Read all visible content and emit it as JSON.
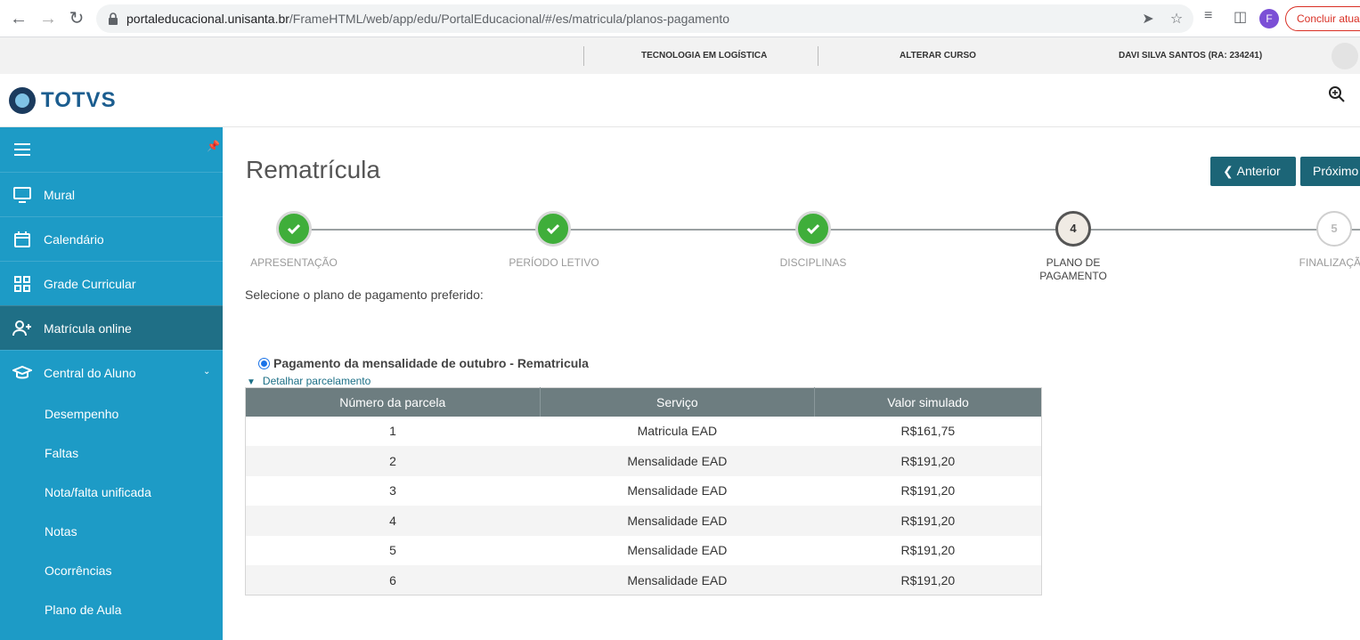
{
  "browser": {
    "url_host": "portaleducacional.unisanta.br",
    "url_path": "/FrameHTML/web/app/edu/PortalEducacional/#/es/matricula/planos-pagamento",
    "profile_initial": "F",
    "update_label": "Concluir atualização"
  },
  "topbar": {
    "course": "TECNOLOGIA EM LOGÍSTICA",
    "change_course": "ALTERAR CURSO",
    "user": "DAVI SILVA SANTOS (RA: 234241)"
  },
  "header": {
    "logo_text": "TOTVS"
  },
  "sidebar": {
    "items": [
      {
        "label": "Mural",
        "icon": "monitor-icon"
      },
      {
        "label": "Calendário",
        "icon": "calendar-icon"
      },
      {
        "label": "Grade Curricular",
        "icon": "grid-icon"
      },
      {
        "label": "Matrícula online",
        "icon": "add-user-icon"
      },
      {
        "label": "Central do Aluno",
        "icon": "graduation-cap-icon"
      }
    ],
    "subitems": [
      "Desempenho",
      "Faltas",
      "Nota/falta unificada",
      "Notas",
      "Ocorrências",
      "Plano de Aula"
    ]
  },
  "main": {
    "title": "Rematrícula",
    "prev_label": "Anterior",
    "next_label": "Próximo",
    "steps": [
      {
        "label": "APRESENTAÇÃO",
        "state": "done"
      },
      {
        "label": "PERÍODO LETIVO",
        "state": "done"
      },
      {
        "label": "DISCIPLINAS",
        "state": "done"
      },
      {
        "label": "PLANO DE PAGAMENTO",
        "number": "4",
        "state": "current"
      },
      {
        "label": "FINALIZAÇÃO",
        "number": "5",
        "state": "pending"
      }
    ],
    "intro": "Selecione o plano de pagamento preferido:",
    "option_label": "Pagamento da mensalidade de outubro - Rematricula",
    "detail_link": "Detalhar parcelamento",
    "table": {
      "headers": [
        "Número da parcela",
        "Serviço",
        "Valor simulado"
      ],
      "rows": [
        [
          "1",
          "Matricula EAD",
          "R$161,75"
        ],
        [
          "2",
          "Mensalidade EAD",
          "R$191,20"
        ],
        [
          "3",
          "Mensalidade EAD",
          "R$191,20"
        ],
        [
          "4",
          "Mensalidade EAD",
          "R$191,20"
        ],
        [
          "5",
          "Mensalidade EAD",
          "R$191,20"
        ],
        [
          "6",
          "Mensalidade EAD",
          "R$191,20"
        ]
      ]
    }
  },
  "colors": {
    "sidebar": "#1d9bc6",
    "sidebar_active": "#1f6f86",
    "button": "#1c6577",
    "step_done": "#3fae3a",
    "table_header": "#6d7d80"
  }
}
